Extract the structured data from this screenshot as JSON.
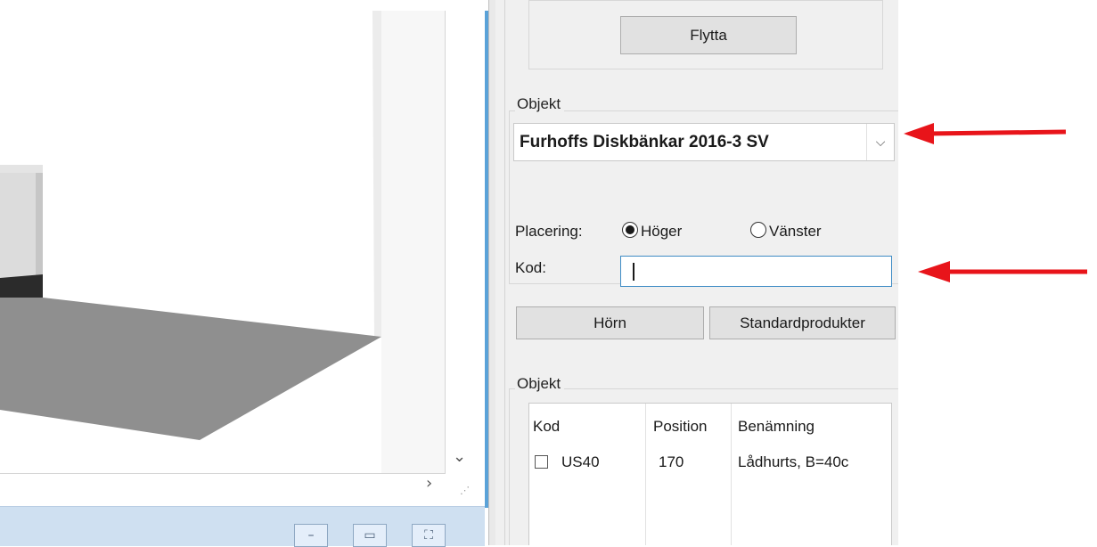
{
  "move_group": {
    "button_label": "Flytta"
  },
  "object_selector": {
    "group_label": "Objekt",
    "selected_value": "Furhoffs Diskbänkar 2016-3 SV",
    "dropdown_icon": "chevron-down-icon"
  },
  "placement": {
    "label": "Placering:",
    "options": [
      {
        "label": "Höger",
        "checked": true
      },
      {
        "label": "Vänster",
        "checked": false
      }
    ]
  },
  "code": {
    "label": "Kod:",
    "value": ""
  },
  "actions": {
    "corner_label": "Hörn",
    "standard_label": "Standardprodukter"
  },
  "objects_list": {
    "group_label": "Objekt",
    "columns": [
      "Kod",
      "Position",
      "Benämning"
    ],
    "rows": [
      {
        "kod": "US40",
        "position": "170",
        "benamning": "Lådhurts, B=40c",
        "checked": false
      }
    ]
  },
  "viewport": {
    "scroll_down_icon": "chevron-down-icon",
    "scroll_right_icon": "chevron-right-icon",
    "resize_grip_icon": "resize-grip-icon"
  },
  "colors": {
    "annotation_arrow": "#e8141a",
    "panel_background": "#f0f0f0",
    "splitter": "#5aa2d8",
    "floor": "#8f8f8f"
  }
}
